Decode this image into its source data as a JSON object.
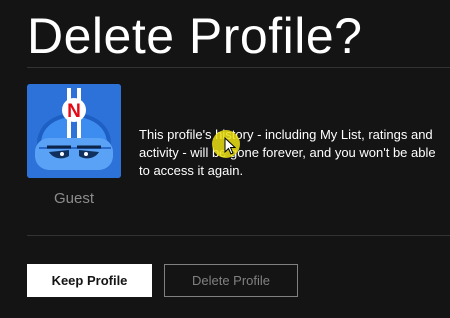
{
  "page": {
    "title": "Delete Profile?"
  },
  "profile": {
    "name": "Guest",
    "avatar_icon": "netflix-kids-avatar-icon",
    "avatar_badge": "N",
    "message": "This profile's history - including My List, ratings and activity - will be gone forever, and you won't be able to access it again."
  },
  "actions": {
    "keep_label": "Keep Profile",
    "delete_label": "Delete Profile"
  },
  "colors": {
    "background": "#141414",
    "avatar_blue": "#2c72d8",
    "brand_red": "#e50914",
    "cursor_highlight": "#ebe114"
  }
}
